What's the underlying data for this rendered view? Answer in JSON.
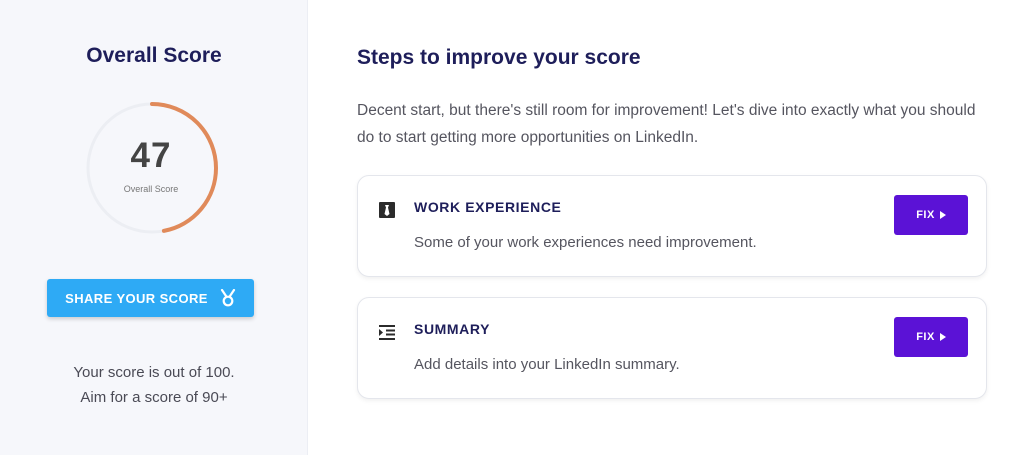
{
  "sidebar": {
    "title": "Overall Score",
    "score": {
      "value": "47",
      "max": 100,
      "caption": "Overall Score",
      "ring_color": "#e08a5a",
      "track_color": "#eceef3"
    },
    "share_button": {
      "label": "SHARE YOUR SCORE",
      "icon": "medal-icon",
      "color": "#2eaaf5"
    },
    "note": {
      "line1": "Your score is out of 100.",
      "line2": "Aim for a score of 90+"
    }
  },
  "main": {
    "title": "Steps to improve your score",
    "intro": "Decent start, but there's still room for improvement! Let's dive into exactly what you should do to start getting more opportunities on LinkedIn.",
    "steps": [
      {
        "heading": "WORK EXPERIENCE",
        "text": "Some of your work experiences need improvement.",
        "icon": "necktie-icon",
        "button": "FIX"
      },
      {
        "heading": "SUMMARY",
        "text": "Add details into your LinkedIn summary.",
        "icon": "indent-list-icon",
        "button": "FIX"
      }
    ],
    "fix_button_color": "#5b12d6"
  }
}
